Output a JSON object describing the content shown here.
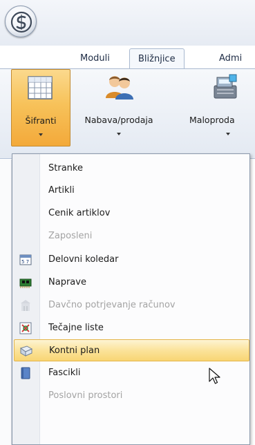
{
  "tabs": [
    {
      "label": "Moduli"
    },
    {
      "label": "Bližnjice"
    },
    {
      "label": "Admi"
    }
  ],
  "ribbon": {
    "buttons": [
      {
        "label": "Šifranti",
        "icon": "grid-table-icon"
      },
      {
        "label": "Nabava/prodaja",
        "icon": "people-icon"
      },
      {
        "label": "Maloproda",
        "icon": "cash-register-icon"
      }
    ]
  },
  "menu": {
    "items": [
      {
        "label": "Stranke",
        "enabled": true
      },
      {
        "label": "Artikli",
        "enabled": true
      },
      {
        "label": "Cenik artiklov",
        "enabled": true
      },
      {
        "label": "Zaposleni",
        "enabled": false
      },
      {
        "label": "Delovni koledar",
        "enabled": true,
        "icon": "calendar-icon"
      },
      {
        "label": "Naprave",
        "enabled": true,
        "icon": "circuit-board-icon"
      },
      {
        "label": "Davčno potrjevanje računov",
        "enabled": false,
        "icon": "building-icon"
      },
      {
        "label": "Tečajne liste",
        "enabled": true,
        "icon": "exchange-icon"
      },
      {
        "label": "Kontni plan",
        "enabled": true,
        "icon": "book-icon",
        "hovered": true
      },
      {
        "label": "Fascikli",
        "enabled": true,
        "icon": "folder-icon"
      },
      {
        "label": "Poslovni prostori",
        "enabled": false
      }
    ]
  },
  "colors": {
    "pressed_button": "#f7c25a",
    "hover_item": "#fbe39a",
    "disabled_text": "#a3a3a3"
  }
}
